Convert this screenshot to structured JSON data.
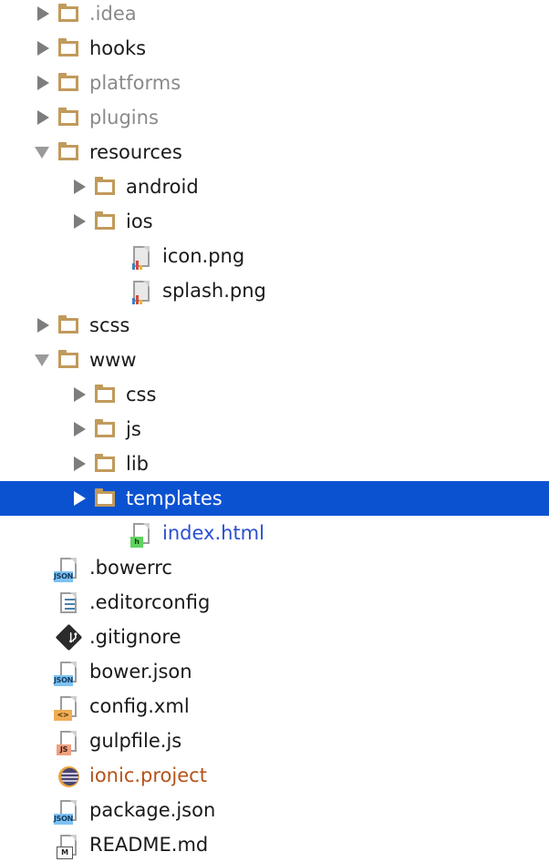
{
  "tree": {
    "selection_color": "#0b52d1",
    "folder_color": "#c19a5b",
    "rows": [
      {
        "name": ".idea",
        "depth": 1,
        "type": "folder",
        "twisty": "closed",
        "style": "dim",
        "icon": "folder-icon"
      },
      {
        "name": "hooks",
        "depth": 1,
        "type": "folder",
        "twisty": "closed",
        "style": "normal",
        "icon": "folder-icon"
      },
      {
        "name": "platforms",
        "depth": 1,
        "type": "folder",
        "twisty": "closed",
        "style": "dim",
        "icon": "folder-icon"
      },
      {
        "name": "plugins",
        "depth": 1,
        "type": "folder",
        "twisty": "closed",
        "style": "dim",
        "icon": "folder-icon"
      },
      {
        "name": "resources",
        "depth": 1,
        "type": "folder",
        "twisty": "open",
        "style": "normal",
        "icon": "folder-icon"
      },
      {
        "name": "android",
        "depth": 2,
        "type": "folder",
        "twisty": "closed",
        "style": "normal",
        "icon": "folder-icon"
      },
      {
        "name": "ios",
        "depth": 2,
        "type": "folder",
        "twisty": "closed",
        "style": "normal",
        "icon": "folder-icon"
      },
      {
        "name": "icon.png",
        "depth": 3,
        "type": "png",
        "twisty": "none",
        "style": "normal",
        "icon": "image-file-icon"
      },
      {
        "name": "splash.png",
        "depth": 3,
        "type": "png",
        "twisty": "none",
        "style": "normal",
        "icon": "image-file-icon"
      },
      {
        "name": "scss",
        "depth": 1,
        "type": "folder",
        "twisty": "closed",
        "style": "normal",
        "icon": "folder-icon"
      },
      {
        "name": "www",
        "depth": 1,
        "type": "folder",
        "twisty": "open",
        "style": "normal",
        "icon": "folder-icon"
      },
      {
        "name": "css",
        "depth": 2,
        "type": "folder",
        "twisty": "closed",
        "style": "normal",
        "icon": "folder-icon"
      },
      {
        "name": "js",
        "depth": 2,
        "type": "folder",
        "twisty": "closed",
        "style": "normal",
        "icon": "folder-icon"
      },
      {
        "name": "lib",
        "depth": 2,
        "type": "folder",
        "twisty": "closed",
        "style": "normal",
        "icon": "folder-icon"
      },
      {
        "name": "templates",
        "depth": 2,
        "type": "folder",
        "twisty": "closed",
        "style": "normal",
        "icon": "folder-icon",
        "selected": true
      },
      {
        "name": "index.html",
        "depth": 3,
        "type": "html",
        "twisty": "none",
        "style": "blue",
        "icon": "html-file-icon",
        "badge": "h"
      },
      {
        "name": ".bowerrc",
        "depth": 1,
        "type": "json",
        "twisty": "none",
        "style": "normal",
        "icon": "json-file-icon",
        "badge": "JSON"
      },
      {
        "name": ".editorconfig",
        "depth": 1,
        "type": "text",
        "twisty": "none",
        "style": "normal",
        "icon": "text-file-icon"
      },
      {
        "name": ".gitignore",
        "depth": 1,
        "type": "git",
        "twisty": "none",
        "style": "normal",
        "icon": "git-file-icon"
      },
      {
        "name": "bower.json",
        "depth": 1,
        "type": "json",
        "twisty": "none",
        "style": "normal",
        "icon": "json-file-icon",
        "badge": "JSON"
      },
      {
        "name": "config.xml",
        "depth": 1,
        "type": "xml",
        "twisty": "none",
        "style": "normal",
        "icon": "xml-file-icon",
        "badge": "<>"
      },
      {
        "name": "gulpfile.js",
        "depth": 1,
        "type": "js",
        "twisty": "none",
        "style": "normal",
        "icon": "javascript-file-icon",
        "badge": "JS"
      },
      {
        "name": "ionic.project",
        "depth": 1,
        "type": "ionic",
        "twisty": "none",
        "style": "orange",
        "icon": "ionic-project-icon"
      },
      {
        "name": "package.json",
        "depth": 1,
        "type": "json",
        "twisty": "none",
        "style": "normal",
        "icon": "json-file-icon",
        "badge": "JSON"
      },
      {
        "name": "README.md",
        "depth": 1,
        "type": "md",
        "twisty": "none",
        "style": "normal",
        "icon": "markdown-file-icon",
        "badge": "M"
      }
    ]
  }
}
